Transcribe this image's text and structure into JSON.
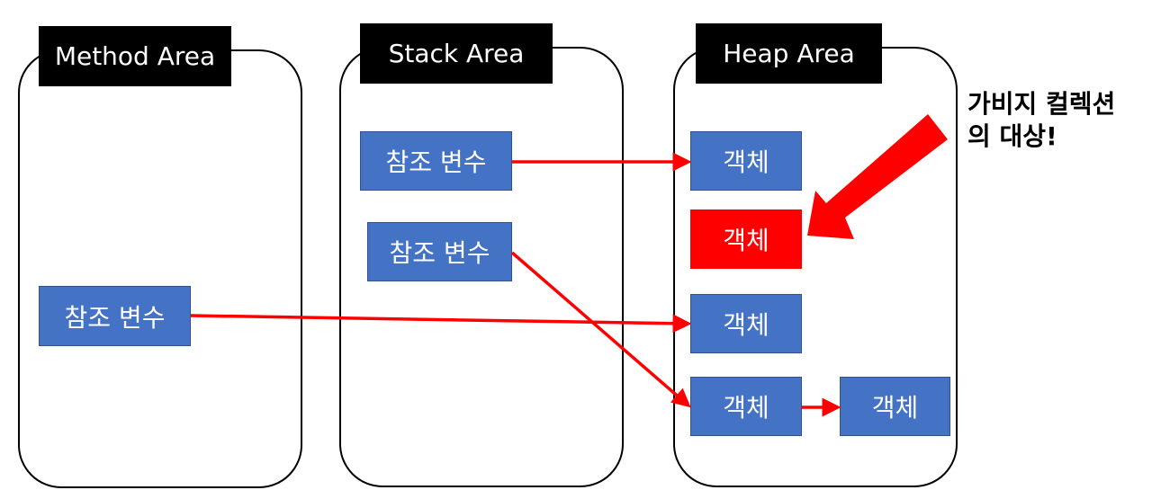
{
  "areas": {
    "method": {
      "title": "Method Area"
    },
    "stack": {
      "title": "Stack Area"
    },
    "heap": {
      "title": "Heap Area"
    }
  },
  "method_area": {
    "reference_variables": [
      {
        "label": "참조 변수"
      }
    ]
  },
  "stack_area": {
    "reference_variables": [
      {
        "label": "참조 변수"
      },
      {
        "label": "참조 변수"
      }
    ]
  },
  "heap_area": {
    "objects": [
      {
        "label": "객체",
        "status": "referenced"
      },
      {
        "label": "객체",
        "status": "unreferenced"
      },
      {
        "label": "객체",
        "status": "referenced"
      },
      {
        "label": "객체",
        "status": "referenced"
      },
      {
        "label": "객체",
        "status": "referenced"
      }
    ]
  },
  "references": [
    {
      "from": "stack_area.reference_variables.0",
      "to": "heap_area.objects.0"
    },
    {
      "from": "stack_area.reference_variables.1",
      "to": "heap_area.objects.3"
    },
    {
      "from": "method_area.reference_variables.0",
      "to": "heap_area.objects.2"
    },
    {
      "from": "heap_area.objects.3",
      "to": "heap_area.objects.4"
    }
  ],
  "annotation": {
    "line1": "가비지 컬렉션",
    "line2": "의 대상!",
    "target": "heap_area.objects.1"
  },
  "colors": {
    "object_fill": "#4472c4",
    "garbage_fill": "#ff0000",
    "arrow": "#ff0000",
    "label_bg": "#000000"
  }
}
